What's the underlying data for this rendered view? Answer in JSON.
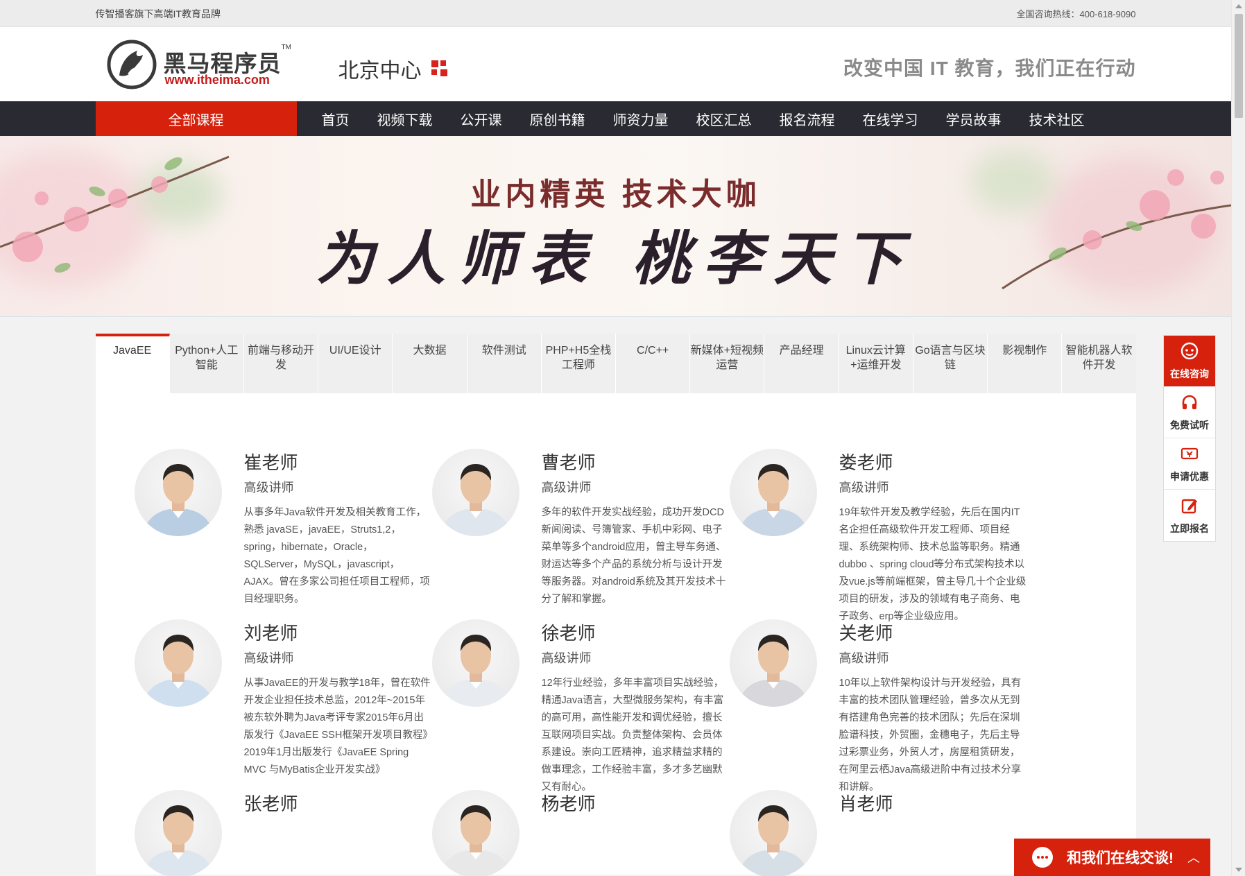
{
  "topbar": {
    "slogan": "传智播客旗下高端IT教育品牌",
    "hotline": "全国咨询热线：400-618-9090"
  },
  "header": {
    "logo_name": "黑马程序员",
    "logo_tm": "TM",
    "logo_url": "www.itheima.com",
    "campus": "北京中心",
    "tagline": "改变中国 IT 教育，我们正在行动"
  },
  "nav": {
    "all_courses": "全部课程",
    "links": [
      "首页",
      "视频下载",
      "公开课",
      "原创书籍",
      "师资力量",
      "校区汇总",
      "报名流程",
      "在线学习",
      "学员故事",
      "技术社区"
    ]
  },
  "banner": {
    "line1": "业内精英  技术大咖",
    "line2": "为人师表 桃李天下"
  },
  "course_tabs": [
    "JavaEE",
    "Python+人工智能",
    "前端与移动开发",
    "UI/UE设计",
    "大数据",
    "软件测试",
    "PHP+H5全栈工程师",
    "C/C++",
    "新媒体+短视频运营",
    "产品经理",
    "Linux云计算+运维开发",
    "Go语言与区块链",
    "影视制作",
    "智能机器人软件开发"
  ],
  "active_tab": "JavaEE",
  "teachers": [
    {
      "name": "崔老师",
      "title": "高级讲师",
      "desc": "从事多年Java软件开发及相关教育工作，熟悉 javaSE，javaEE，Struts1,2，spring，hibernate，Oracle，SQLServer，MySQL，javascript，AJAX。曾在多家公司担任项目工程师，项目经理职务。"
    },
    {
      "name": "曹老师",
      "title": "高级讲师",
      "desc": "多年的软件开发实战经验，成功开发DCD新闻阅读、号簿管家、手机中彩网、电子菜单等多个android应用，曾主导车务通、财运达等多个产品的系统分析与设计开发 等服务器。对android系统及其开发技术十分了解和掌握。"
    },
    {
      "name": "娄老师",
      "title": "高级讲师",
      "desc": "19年软件开发及教学经验，先后在国内IT名企担任高级软件开发工程师、项目经理、系统架构师、技术总监等职务。精通dubbo 、spring cloud等分布式架构技术以及vue.js等前端框架，曾主导几十个企业级项目的研发，涉及的领域有电子商务、电子政务、erp等企业级应用。"
    },
    {
      "name": "刘老师",
      "title": "高级讲师",
      "desc": "从事JavaEE的开发与教学18年，曾在软件开发企业担任技术总监，2012年~2015年被东软外聘为Java考评专家2015年6月出版发行《JavaEE SSH框架开发项目教程》2019年1月出版发行《JavaEE Spring MVC 与MyBatis企业开发实战》"
    },
    {
      "name": "徐老师",
      "title": "高级讲师",
      "desc": "12年行业经验，多年丰富项目实战经验，精通Java语言，大型微服务架构，有丰富的高可用，高性能开发和调优经验，擅长互联网项目实战。负责整体架构、会员体系建设。崇向工匠精神，追求精益求精的做事理念，工作经验丰富，多才多艺幽默又有耐心。"
    },
    {
      "name": "关老师",
      "title": "高级讲师",
      "desc": "10年以上软件架构设计与开发经验，具有丰富的技术团队管理经验，曾多次从无到有搭建角色完善的技术团队；先后在深圳脸谱科技，外贸圈，金穗电子，先后主导过彩票业务，外贸人才，房屋租赁研发，在阿里云栖Java高级进阶中有过技术分享和讲解。"
    },
    {
      "name": "张老师",
      "title": "",
      "desc": ""
    },
    {
      "name": "杨老师",
      "title": "",
      "desc": ""
    },
    {
      "name": "肖老师",
      "title": "",
      "desc": ""
    }
  ],
  "side_menu": [
    {
      "label": "在线咨询",
      "icon": "service-icon"
    },
    {
      "label": "免费试听",
      "icon": "headphones-icon"
    },
    {
      "label": "申请优惠",
      "icon": "ticket-icon"
    },
    {
      "label": "立即报名",
      "icon": "edit-icon"
    }
  ],
  "chatbar": {
    "label": "和我们在线交谈!",
    "caret": "︿"
  },
  "colors": {
    "brand_red": "#d6210d",
    "nav_bg": "#2a2a33"
  }
}
